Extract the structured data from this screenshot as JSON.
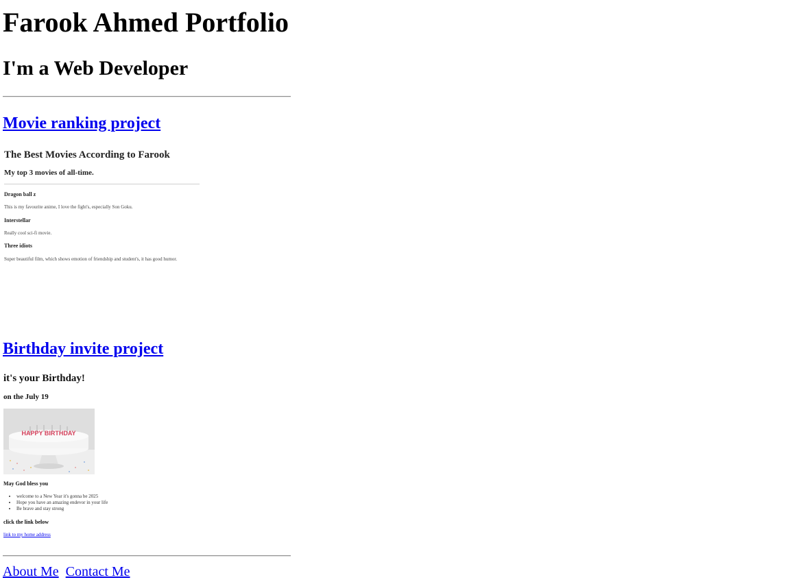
{
  "header": {
    "title": "Farook Ahmed Portfolio",
    "subtitle": "I'm a Web Developer"
  },
  "projects": {
    "movie": {
      "link_label": "Movie ranking project",
      "preview": {
        "title": "The Best Movies According to Farook",
        "subtitle": "My top 3 movies of all-time.",
        "movies": [
          {
            "name": "Dragon ball z",
            "description": "This is my favourite anime, I love the fight's, especially Son Goku."
          },
          {
            "name": "Interstellar",
            "description": "Really cool sci-fi movie."
          },
          {
            "name": "Three idiots",
            "description": "Super beautiful film, which shows emotion of friendship and student's, it has good humor."
          }
        ]
      }
    },
    "birthday": {
      "link_label": "Birthday invite project",
      "preview": {
        "title": "it's your Birthday!",
        "date": "on the July 19",
        "image_text": "HAPPY BIRTHDAY",
        "blessing": "May God bless you",
        "wishes": [
          "welcome to a New Year it's gonna be 2025",
          "Hope you have an amazing endevor in your life",
          "Be brave and stay strong"
        ],
        "click_label": "click the link below",
        "home_link": "link to my home address"
      }
    }
  },
  "footer": {
    "about_label": "About Me",
    "contact_label": "Contact Me"
  },
  "colors": {
    "link": "#0000ee",
    "text": "#000000"
  }
}
